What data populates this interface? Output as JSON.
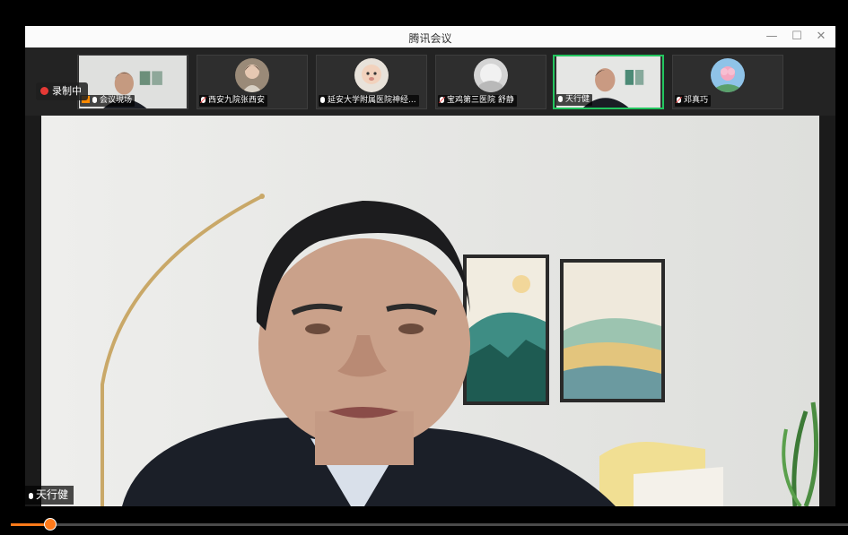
{
  "window": {
    "title": "腾讯会议",
    "controls": {
      "minimize": "—",
      "maximize": "☐",
      "close": "✕"
    }
  },
  "recording": {
    "label": "录制中"
  },
  "participants": [
    {
      "name": "会议現场",
      "mic": "on",
      "badge": true
    },
    {
      "name": "西安九院张西安",
      "mic": "muted"
    },
    {
      "name": "延安大学附属医院神经...",
      "mic": "on"
    },
    {
      "name": "宝鸡第三医院  舒静",
      "mic": "muted"
    },
    {
      "name": "天行健",
      "mic": "on",
      "active": true
    },
    {
      "name": "邓真巧",
      "mic": "muted"
    }
  ],
  "main_video": {
    "speaker_name": "天行健"
  },
  "playback": {
    "progress": 0.047
  },
  "colors": {
    "active_border": "#22c55e",
    "record_dot": "#e53935",
    "progress": "#ff7a1a"
  }
}
